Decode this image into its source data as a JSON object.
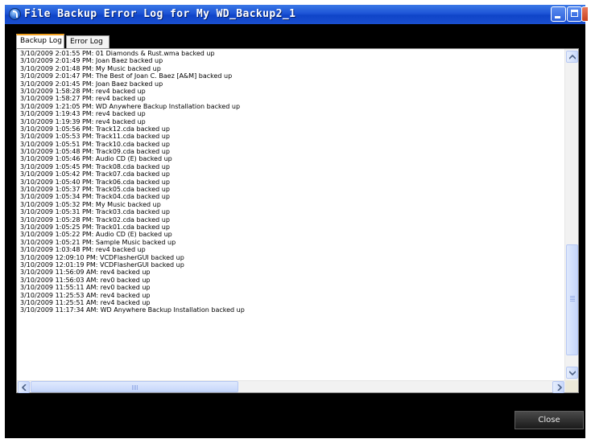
{
  "window": {
    "title": "File Backup Error Log for My WD_Backup2_1"
  },
  "tabs": [
    {
      "label": "Backup Log",
      "active": true
    },
    {
      "label": "Error Log",
      "active": false
    }
  ],
  "log_lines": [
    "3/10/2009 2:01:55 PM: 01 Diamonds & Rust.wma backed up",
    "3/10/2009 2:01:49 PM: Joan Baez backed up",
    "3/10/2009 2:01:48 PM: My Music backed up",
    "3/10/2009 2:01:47 PM: The Best of Joan C. Baez [A&M] backed up",
    "3/10/2009 2:01:45 PM: Joan Baez backed up",
    "3/10/2009 1:58:28 PM: rev4 backed up",
    "3/10/2009 1:58:27 PM: rev4 backed up",
    "3/10/2009 1:21:05 PM: WD Anywhere Backup Installation backed up",
    "3/10/2009 1:19:43 PM: rev4 backed up",
    "3/10/2009 1:19:39 PM: rev4 backed up",
    "3/10/2009 1:05:56 PM: Track12.cda backed up",
    "3/10/2009 1:05:53 PM: Track11.cda backed up",
    "3/10/2009 1:05:51 PM: Track10.cda backed up",
    "3/10/2009 1:05:48 PM: Track09.cda backed up",
    "3/10/2009 1:05:46 PM: Audio CD (E) backed up",
    "3/10/2009 1:05:45 PM: Track08.cda backed up",
    "3/10/2009 1:05:42 PM: Track07.cda backed up",
    "3/10/2009 1:05:40 PM: Track06.cda backed up",
    "3/10/2009 1:05:37 PM: Track05.cda backed up",
    "3/10/2009 1:05:34 PM: Track04.cda backed up",
    "3/10/2009 1:05:32 PM: My Music backed up",
    "3/10/2009 1:05:31 PM: Track03.cda backed up",
    "3/10/2009 1:05:28 PM: Track02.cda backed up",
    "3/10/2009 1:05:25 PM: Track01.cda backed up",
    "3/10/2009 1:05:22 PM: Audio CD (E) backed up",
    "3/10/2009 1:05:21 PM: Sample Music backed up",
    "3/10/2009 1:03:48 PM: rev4 backed up",
    "3/10/2009 12:09:10 PM: VCDFlasherGUI backed up",
    "3/10/2009 12:01:19 PM: VCDFlasherGUI backed up",
    "3/10/2009 11:56:09 AM: rev4 backed up",
    "3/10/2009 11:56:03 AM: rev0 backed up",
    "3/10/2009 11:55:11 AM: rev0 backed up",
    "3/10/2009 11:25:53 AM: rev4 backed up",
    "3/10/2009 11:25:51 AM: rev4 backed up",
    "3/10/2009 11:17:34 AM: WD Anywhere Backup Installation backed up"
  ],
  "buttons": {
    "close_label": "Close"
  },
  "colors": {
    "titlebar": "#1d54d6",
    "window_bg": "#000000",
    "log_bg": "#ffffff",
    "active_tab_accent": "#f0a020"
  },
  "icons": {
    "app": "wd-backup-icon",
    "minimize": "minimize-icon",
    "maximize": "maximize-icon",
    "close": "close-icon"
  }
}
